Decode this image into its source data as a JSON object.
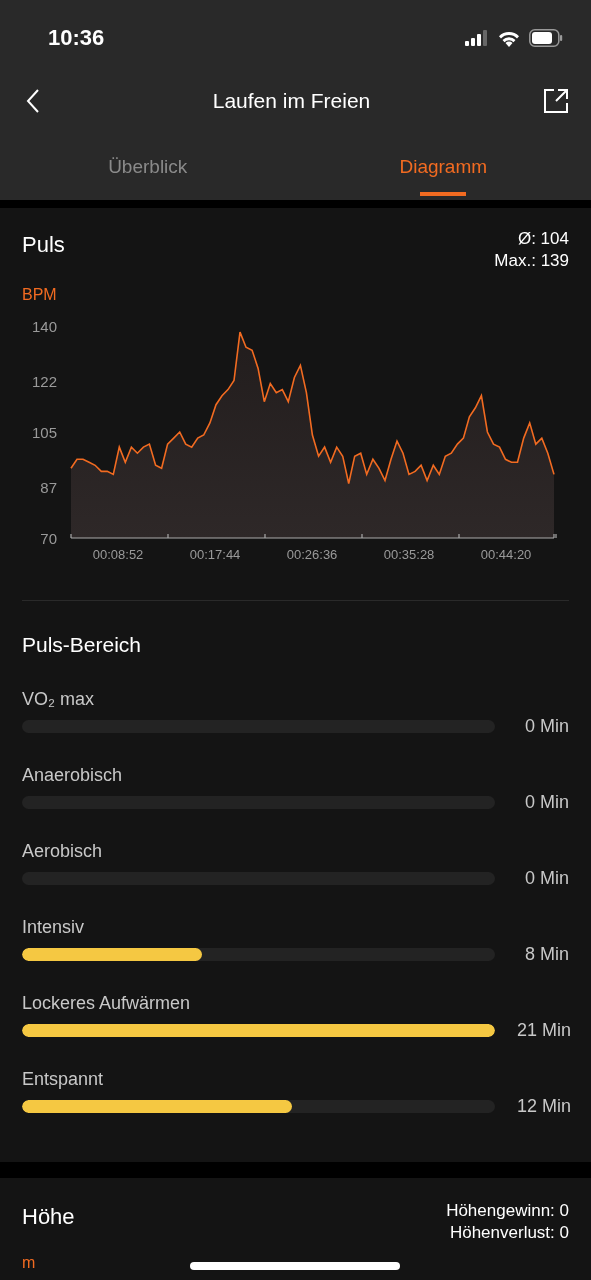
{
  "status_bar": {
    "time": "10:36"
  },
  "nav": {
    "title": "Laufen im Freien"
  },
  "tabs": [
    {
      "label": "Überblick",
      "selected": false
    },
    {
      "label": "Diagramm",
      "selected": true
    }
  ],
  "pulse": {
    "title": "Puls",
    "stats": [
      "Ø: 104",
      "Max.: 139"
    ],
    "chart_data": {
      "type": "area",
      "ylabel": "BPM",
      "ylim": [
        70,
        140
      ],
      "yticks": [
        70,
        87,
        105,
        122,
        140
      ],
      "xlim": [
        274,
        2923
      ],
      "x": [
        274,
        307,
        340,
        373,
        406,
        440,
        473,
        506,
        539,
        572,
        605,
        638,
        671,
        704,
        738,
        771,
        804,
        837,
        870,
        903,
        936,
        969,
        1002,
        1036,
        1069,
        1102,
        1135,
        1168,
        1201,
        1234,
        1267,
        1300,
        1334,
        1367,
        1400,
        1433,
        1466,
        1499,
        1532,
        1565,
        1598,
        1632,
        1665,
        1698,
        1731,
        1764,
        1797,
        1830,
        1863,
        1896,
        1930,
        1963,
        1996,
        2029,
        2062,
        2095,
        2128,
        2161,
        2194,
        2227,
        2261,
        2294,
        2327,
        2360,
        2393,
        2426,
        2459,
        2492,
        2525,
        2558,
        2591,
        2624,
        2657,
        2690,
        2723,
        2757,
        2790,
        2823,
        2856,
        2889,
        2923
      ],
      "xticks": [
        {
          "value": 532,
          "label": "00:08:52"
        },
        {
          "value": 1064,
          "label": "00:17:44"
        },
        {
          "value": 1596,
          "label": "00:26:36"
        },
        {
          "value": 2128,
          "label": "00:35:28"
        },
        {
          "value": 2660,
          "label": "00:44:20"
        }
      ],
      "series": [
        {
          "color": "#f26b21",
          "values": [
            93,
            96,
            96,
            95,
            94,
            92,
            92,
            91,
            100,
            95,
            100,
            98,
            100,
            101,
            94,
            93,
            101,
            103,
            105,
            101,
            100,
            103,
            104,
            108,
            114,
            117,
            119,
            122,
            138,
            133,
            132,
            126,
            115,
            121,
            118,
            119,
            115,
            123,
            127,
            118,
            104,
            97,
            100,
            95,
            100,
            97,
            88,
            97,
            98,
            91,
            96,
            93,
            89,
            96,
            102,
            98,
            91,
            92,
            94,
            89,
            94,
            91,
            97,
            98,
            101,
            103,
            110,
            113,
            117,
            105,
            101,
            100,
            96,
            95,
            95,
            103,
            108,
            101,
            103,
            98,
            91
          ]
        }
      ]
    }
  },
  "zones": {
    "title": "Puls-Bereich",
    "items": [
      {
        "name": "VO₂ max",
        "reading": "0 Min"
      },
      {
        "name": "Anaerobisch",
        "reading": "0 Min"
      },
      {
        "name": "Aerobisch",
        "reading": "0 Min"
      },
      {
        "name": "Intensiv",
        "level": 0.38,
        "reading": "8 Min"
      },
      {
        "name": "Lockeres Aufwärmen",
        "level": 1,
        "reading": "21 Min"
      },
      {
        "name": "Entspannt",
        "level": 0.57,
        "reading": "12 Min"
      }
    ]
  },
  "altitude": {
    "title": "Höhe",
    "stats": [
      "Höhengewinn: 0",
      "Höhenverlust: 0"
    ],
    "unit": "m"
  }
}
